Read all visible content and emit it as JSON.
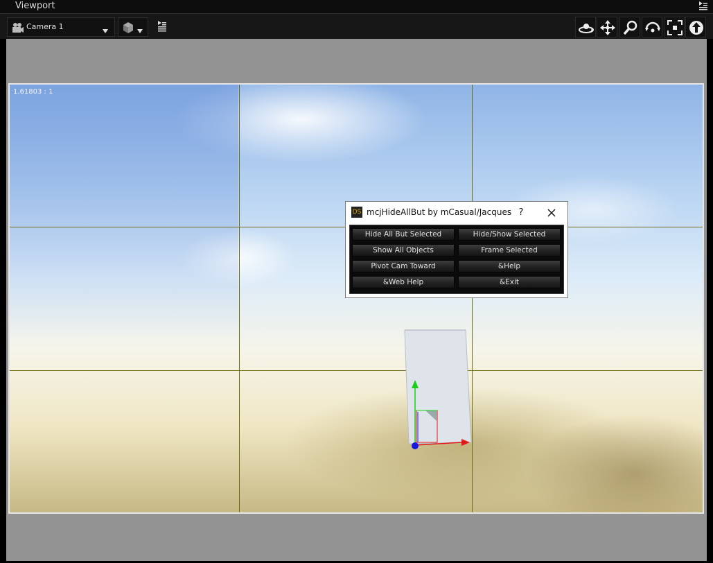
{
  "window": {
    "title": "Viewport"
  },
  "toolbar": {
    "camera": {
      "label": "Camera 1"
    }
  },
  "viewport": {
    "aspect_ratio": "1.61803 : 1"
  },
  "dialog": {
    "title": "mcjHideAllBut by mCasual/Jacques",
    "app_icon_text": "DS",
    "help_label": "?",
    "buttons": [
      {
        "label": "Hide All But Selected"
      },
      {
        "label": "Hide/Show Selected"
      },
      {
        "label": "Show All Objects"
      },
      {
        "label": "Frame Selected"
      },
      {
        "label": "Pivot Cam Toward"
      },
      {
        "label": "&Help"
      },
      {
        "label": "&Web Help"
      },
      {
        "label": "&Exit"
      }
    ]
  },
  "colors": {
    "grid_line": "#6b6b12",
    "gizmo_x": "#e01818",
    "gizmo_y": "#18d018",
    "gizmo_z": "#1818e0"
  }
}
